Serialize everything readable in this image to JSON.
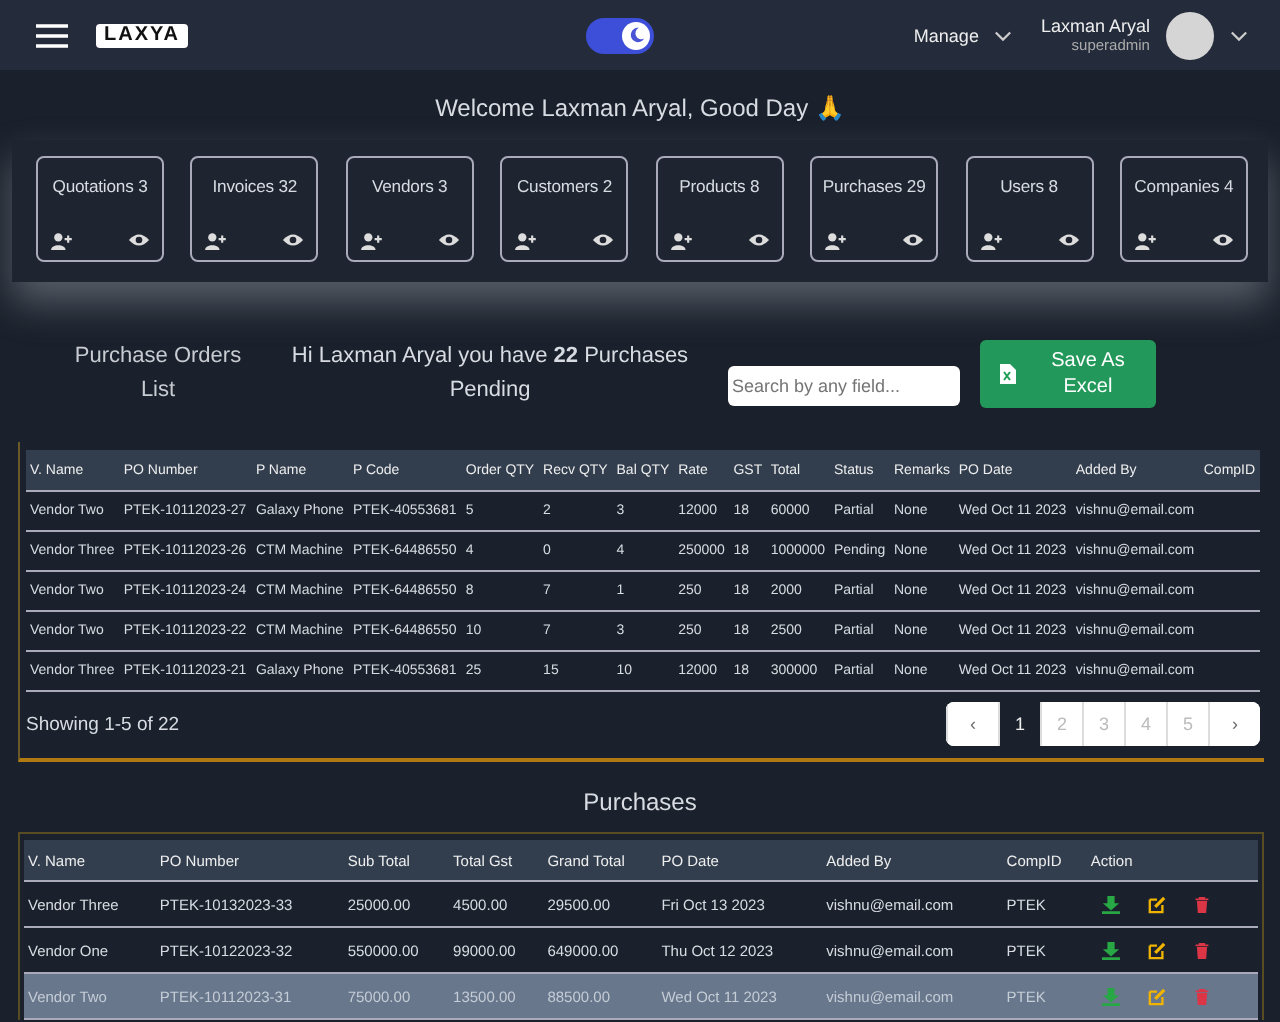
{
  "navbar": {
    "logo": "LAXYA",
    "dark_mode": {
      "on": true
    },
    "manage": "Manage",
    "user": {
      "name": "Laxman Aryal",
      "role": "superadmin"
    }
  },
  "welcome": "Welcome Laxman Aryal, Good Day 🙏",
  "cards": [
    {
      "label": "Quotations 3"
    },
    {
      "label": "Invoices 32"
    },
    {
      "label": "Vendors 3"
    },
    {
      "label": "Customers 2"
    },
    {
      "label": "Products 8"
    },
    {
      "label": "Purchases 29"
    },
    {
      "label": "Users 8"
    },
    {
      "label": "Companies 4"
    }
  ],
  "purchase_orders": {
    "title": "Purchase Orders List",
    "message": "Hi Laxman Aryal you have **22** Purchases Pending",
    "search": {
      "placeholder": "Search by any field..."
    },
    "export_button": "Save As Excel",
    "columns": [
      "V. Name",
      "PO Number",
      "P Name",
      "P Code",
      "Order QTY",
      "Recv QTY",
      "Bal QTY",
      "Rate",
      "GST",
      "Total",
      "Status",
      "Remarks",
      "PO Date",
      "Added By",
      "CompID"
    ],
    "rows": [
      [
        "Vendor Two",
        "PTEK-10112023-27",
        "Galaxy Phone",
        "PTEK-40553681",
        "5",
        "2",
        "3",
        "12000",
        "18",
        "60000",
        "Partial",
        "None",
        "Wed Oct 11 2023",
        "vishnu@email.com"
      ],
      [
        "Vendor Three",
        "PTEK-10112023-26",
        "CTM Machine",
        "PTEK-64486550",
        "4",
        "0",
        "4",
        "250000",
        "18",
        "1000000",
        "Pending",
        "None",
        "Wed Oct 11 2023",
        "vishnu@email.com"
      ],
      [
        "Vendor Two",
        "PTEK-10112023-24",
        "CTM Machine",
        "PTEK-64486550",
        "8",
        "7",
        "1",
        "250",
        "18",
        "2000",
        "Partial",
        "None",
        "Wed Oct 11 2023",
        "vishnu@email.com"
      ],
      [
        "Vendor Two",
        "PTEK-10112023-22",
        "CTM Machine",
        "PTEK-64486550",
        "10",
        "7",
        "3",
        "250",
        "18",
        "2500",
        "Partial",
        "None",
        "Wed Oct 11 2023",
        "vishnu@email.com"
      ],
      [
        "Vendor Three",
        "PTEK-10112023-21",
        "Galaxy Phone",
        "PTEK-40553681",
        "25",
        "15",
        "10",
        "12000",
        "18",
        "300000",
        "Partial",
        "None",
        "Wed Oct 11 2023",
        "vishnu@email.com"
      ]
    ],
    "showing": "Showing 1-5 of 22",
    "pagination": {
      "prev": "‹",
      "next": "›",
      "pages": [
        {
          "label": "1",
          "selected": true
        },
        {
          "label": "2",
          "selected": false
        },
        {
          "label": "3",
          "selected": false
        },
        {
          "label": "4",
          "selected": false
        },
        {
          "label": "5",
          "selected": false
        }
      ]
    }
  },
  "purchases": {
    "title": "Purchases",
    "columns": [
      "V. Name",
      "PO Number",
      "Sub Total",
      "Total Gst",
      "Grand Total",
      "PO Date",
      "Added By",
      "CompID",
      "Action"
    ],
    "rows": [
      {
        "cells": [
          "Vendor Three",
          "PTEK-10132023-33",
          "25000.00",
          "4500.00",
          "29500.00",
          "Fri Oct 13 2023",
          "vishnu@email.com",
          "PTEK"
        ],
        "selected": false
      },
      {
        "cells": [
          "Vendor One",
          "PTEK-10122023-32",
          "550000.00",
          "99000.00",
          "649000.00",
          "Thu Oct 12 2023",
          "vishnu@email.com",
          "PTEK"
        ],
        "selected": false
      },
      {
        "cells": [
          "Vendor Two",
          "PTEK-10112023-31",
          "75000.00",
          "13500.00",
          "88500.00",
          "Wed Oct 11 2023",
          "vishnu@email.com",
          "PTEK"
        ],
        "selected": true
      }
    ]
  }
}
